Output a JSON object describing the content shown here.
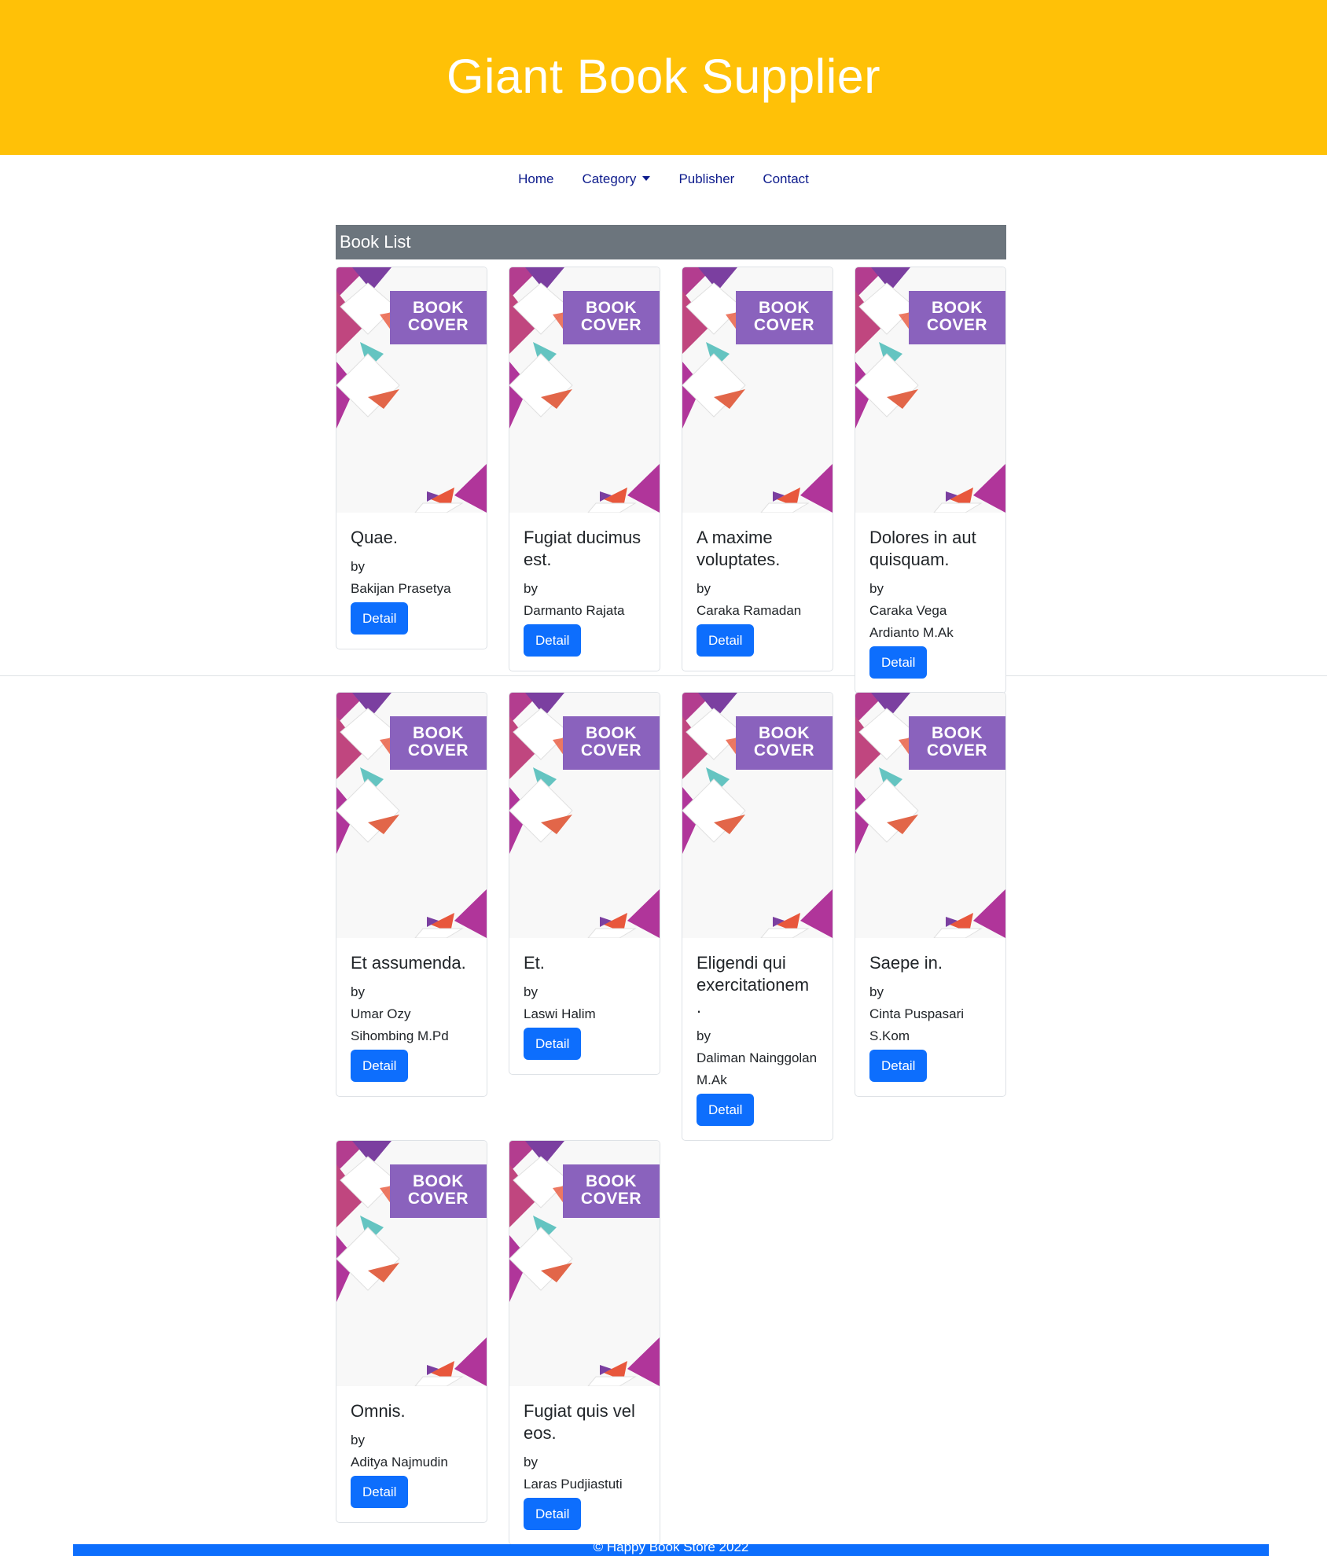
{
  "header": {
    "title": "Giant Book Supplier"
  },
  "nav": {
    "items": [
      {
        "label": "Home"
      },
      {
        "label": "Category"
      },
      {
        "label": "Publisher"
      },
      {
        "label": "Contact"
      }
    ]
  },
  "section": {
    "title": "Book List"
  },
  "cover": {
    "text_line1": "BOOK",
    "text_line2": "COVER"
  },
  "books": [
    {
      "title": "Quae.",
      "by": "by",
      "author": "Bakijan Prasetya",
      "button": "Detail"
    },
    {
      "title": "Fugiat ducimus est.",
      "by": "by",
      "author": "Darmanto Rajata",
      "button": "Detail"
    },
    {
      "title": "A maxime voluptates.",
      "by": "by",
      "author": "Caraka Ramadan",
      "button": "Detail"
    },
    {
      "title": "Dolores in aut quisquam.",
      "by": "by",
      "author": "Caraka Vega Ardianto M.Ak",
      "button": "Detail"
    },
    {
      "title": "Et assumenda.",
      "by": "by",
      "author": "Umar Ozy Sihombing M.Pd",
      "button": "Detail"
    },
    {
      "title": "Et.",
      "by": "by",
      "author": "Laswi Halim",
      "button": "Detail"
    },
    {
      "title": "Eligendi qui exercitationem .",
      "by": "by",
      "author": "Daliman Nainggolan M.Ak",
      "button": "Detail"
    },
    {
      "title": "Saepe in.",
      "by": "by",
      "author": "Cinta Puspasari S.Kom",
      "button": "Detail"
    },
    {
      "title": "Omnis.",
      "by": "by",
      "author": "Aditya Najmudin",
      "button": "Detail"
    },
    {
      "title": "Fugiat quis vel eos.",
      "by": "by",
      "author": "Laras Pudjiastuti",
      "button": "Detail"
    }
  ],
  "footer": {
    "text": "© Happy Book Store 2022"
  },
  "colors": {
    "header_bg": "#ffc107",
    "section_bg": "#6c757d",
    "button_bg": "#0d6efd",
    "cover_banner": "#8a62bd"
  }
}
